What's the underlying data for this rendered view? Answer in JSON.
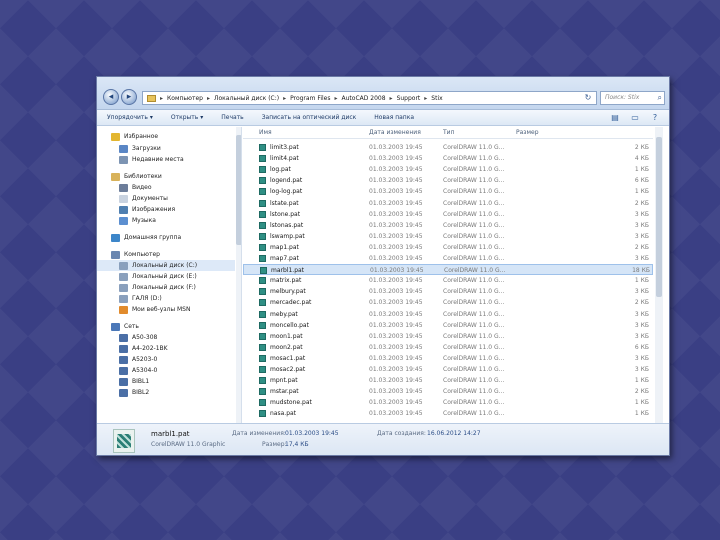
{
  "address": {
    "crumbs": [
      "Компьютер",
      "Локальный диск (C:)",
      "Program Files",
      "AutoCAD 2008",
      "Support",
      "Stix"
    ],
    "search_placeholder": "Поиск: Stix"
  },
  "toolbar": {
    "items": [
      "Упорядочить ▾",
      "Открыть ▾",
      "Печать",
      "Записать на оптический диск",
      "Новая папка"
    ]
  },
  "nav": {
    "items": [
      {
        "label": "Избранное",
        "icon": "star-icon",
        "color": "#e3b630"
      },
      {
        "label": "Загрузки",
        "icon": "downloads-icon",
        "color": "#5a86c5"
      },
      {
        "label": "Недавние места",
        "icon": "recent-places-icon",
        "color": "#7d94b3"
      },
      {
        "label": "Библиотеки",
        "icon": "libraries-icon",
        "color": "#d8b25a"
      },
      {
        "label": "Видео",
        "icon": "video-icon",
        "color": "#6c7d9a"
      },
      {
        "label": "Документы",
        "icon": "documents-icon",
        "color": "#c9d3e0"
      },
      {
        "label": "Изображения",
        "icon": "pictures-icon",
        "color": "#4f7fb0"
      },
      {
        "label": "Музыка",
        "icon": "music-icon",
        "color": "#5c8fd0"
      },
      {
        "label": "Домашняя группа",
        "icon": "homegroup-icon",
        "color": "#3d86c9"
      },
      {
        "label": "Компьютер",
        "icon": "computer-icon",
        "color": "#6b87b0"
      },
      {
        "label": "Локальный диск (C:)",
        "icon": "drive-icon",
        "color": "#8aa0bd"
      },
      {
        "label": "Локальный диск (E:)",
        "icon": "drive-icon",
        "color": "#8aa0bd"
      },
      {
        "label": "Локальный диск (F:)",
        "icon": "drive-icon",
        "color": "#8aa0bd"
      },
      {
        "label": "ГАЛЯ (D:)",
        "icon": "drive-icon",
        "color": "#8aa0bd"
      },
      {
        "label": "Мои веб-узлы MSN",
        "icon": "msn-icon",
        "color": "#e18b2d"
      },
      {
        "label": "Сеть",
        "icon": "network-icon",
        "color": "#4b78b8"
      },
      {
        "label": "A50-308",
        "icon": "network-computer-icon",
        "color": "#4b6fa6"
      },
      {
        "label": "A4-202-1BK",
        "icon": "network-computer-icon",
        "color": "#4b6fa6"
      },
      {
        "label": "A5203-0",
        "icon": "network-computer-icon",
        "color": "#4b6fa6"
      },
      {
        "label": "A5304-0",
        "icon": "network-computer-icon",
        "color": "#4b6fa6"
      },
      {
        "label": "BIBL1",
        "icon": "network-computer-icon",
        "color": "#4b6fa6"
      },
      {
        "label": "BIBL2",
        "icon": "network-computer-icon",
        "color": "#4b6fa6"
      }
    ],
    "selected_index": 10
  },
  "columns": [
    "Имя",
    "Дата изменения",
    "Тип",
    "Размер"
  ],
  "files": [
    {
      "name": "limit3.pat",
      "date": "01.03.2003 19:45",
      "type": "CorelDRAW 11.0 G...",
      "size": "2 КБ"
    },
    {
      "name": "limit4.pat",
      "date": "01.03.2003 19:45",
      "type": "CorelDRAW 11.0 G...",
      "size": "4 КБ"
    },
    {
      "name": "log.pat",
      "date": "01.03.2003 19:45",
      "type": "CorelDRAW 11.0 G...",
      "size": "1 КБ"
    },
    {
      "name": "logend.pat",
      "date": "01.03.2003 19:45",
      "type": "CorelDRAW 11.0 G...",
      "size": "6 КБ"
    },
    {
      "name": "log-log.pat",
      "date": "01.03.2003 19:45",
      "type": "CorelDRAW 11.0 G...",
      "size": "1 КБ"
    },
    {
      "name": "lstate.pat",
      "date": "01.03.2003 19:45",
      "type": "CorelDRAW 11.0 G...",
      "size": "2 КБ"
    },
    {
      "name": "lstone.pat",
      "date": "01.03.2003 19:45",
      "type": "CorelDRAW 11.0 G...",
      "size": "3 КБ"
    },
    {
      "name": "lstonas.pat",
      "date": "01.03.2003 19:45",
      "type": "CorelDRAW 11.0 G...",
      "size": "3 КБ"
    },
    {
      "name": "lswamp.pat",
      "date": "01.03.2003 19:45",
      "type": "CorelDRAW 11.0 G...",
      "size": "3 КБ"
    },
    {
      "name": "map1.pat",
      "date": "01.03.2003 19:45",
      "type": "CorelDRAW 11.0 G...",
      "size": "2 КБ"
    },
    {
      "name": "map7.pat",
      "date": "01.03.2003 19:45",
      "type": "CorelDRAW 11.0 G...",
      "size": "3 КБ"
    },
    {
      "name": "marbl1.pat",
      "date": "01.03.2003 19:45",
      "type": "CorelDRAW 11.0 G...",
      "size": "18 КБ"
    },
    {
      "name": "matrix.pat",
      "date": "01.03.2003 19:45",
      "type": "CorelDRAW 11.0 G...",
      "size": "1 КБ"
    },
    {
      "name": "melbury.pat",
      "date": "01.03.2003 19:45",
      "type": "CorelDRAW 11.0 G...",
      "size": "3 КБ"
    },
    {
      "name": "mercadec.pat",
      "date": "01.03.2003 19:45",
      "type": "CorelDRAW 11.0 G...",
      "size": "2 КБ"
    },
    {
      "name": "meby.pat",
      "date": "01.03.2003 19:45",
      "type": "CorelDRAW 11.0 G...",
      "size": "3 КБ"
    },
    {
      "name": "moncello.pat",
      "date": "01.03.2003 19:45",
      "type": "CorelDRAW 11.0 G...",
      "size": "3 КБ"
    },
    {
      "name": "moon1.pat",
      "date": "01.03.2003 19:45",
      "type": "CorelDRAW 11.0 G...",
      "size": "3 КБ"
    },
    {
      "name": "moon2.pat",
      "date": "01.03.2003 19:45",
      "type": "CorelDRAW 11.0 G...",
      "size": "6 КБ"
    },
    {
      "name": "mosac1.pat",
      "date": "01.03.2003 19:45",
      "type": "CorelDRAW 11.0 G...",
      "size": "3 КБ"
    },
    {
      "name": "mosac2.pat",
      "date": "01.03.2003 19:45",
      "type": "CorelDRAW 11.0 G...",
      "size": "3 КБ"
    },
    {
      "name": "mpnt.pat",
      "date": "01.03.2003 19:45",
      "type": "CorelDRAW 11.0 G...",
      "size": "1 КБ"
    },
    {
      "name": "mstar.pat",
      "date": "01.03.2003 19:45",
      "type": "CorelDRAW 11.0 G...",
      "size": "2 КБ"
    },
    {
      "name": "mudstone.pat",
      "date": "01.03.2003 19:45",
      "type": "CorelDRAW 11.0 G...",
      "size": "1 КБ"
    },
    {
      "name": "nasa.pat",
      "date": "01.03.2003 19:45",
      "type": "CorelDRAW 11.0 G...",
      "size": "1 КБ"
    }
  ],
  "selected_file_index": 11,
  "details": {
    "name": "marbl1.pat",
    "type": "CorelDRAW 11.0 Graphic",
    "modified_label": "Дата изменения:",
    "modified_value": "01.03.2003 19:45",
    "size_label": "Размер:",
    "size_value": "17,4 КБ",
    "created_label": "Дата создания:",
    "created_value": "16.06.2012 14:27"
  }
}
